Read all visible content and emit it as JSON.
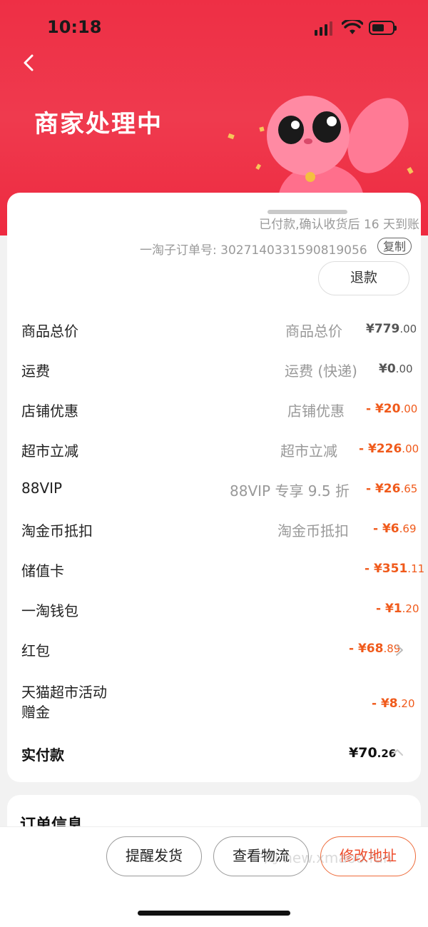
{
  "status": {
    "time": "10:18"
  },
  "header": {
    "title": "商家处理中"
  },
  "order": {
    "paid_note": "已付款,确认收货后 16 天到账",
    "order_no_label": "一淘子订单号: 3027140331590819056",
    "copy_label": "复制",
    "refund_label": "退款"
  },
  "rows": [
    {
      "label": "商品总价",
      "desc": "商品总价",
      "amount_int": "¥779",
      "amount_dec": ".00",
      "red": false
    },
    {
      "label": "运费",
      "desc": "运费 (快递)",
      "amount_int": "¥0",
      "amount_dec": ".00",
      "red": false
    },
    {
      "label": "店铺优惠",
      "desc": "店铺优惠",
      "amount_int": "- ¥20",
      "amount_dec": ".00",
      "red": true
    },
    {
      "label": "超市立减",
      "desc": "超市立减",
      "amount_int": "- ¥226",
      "amount_dec": ".00",
      "red": true
    },
    {
      "label": "88VIP",
      "desc": "88VIP 专享 9.5 折",
      "amount_int": "- ¥26",
      "amount_dec": ".65",
      "red": true
    },
    {
      "label": "淘金币抵扣",
      "desc": "淘金币抵扣",
      "amount_int": "- ¥6",
      "amount_dec": ".69",
      "red": true
    },
    {
      "label": "储值卡",
      "desc": "",
      "amount_int": "- ¥351",
      "amount_dec": ".11",
      "red": true
    },
    {
      "label": "一淘钱包",
      "desc": "",
      "amount_int": "- ¥1",
      "amount_dec": ".20",
      "red": true
    },
    {
      "label": "红包",
      "desc": "",
      "amount_int": "- ¥68",
      "amount_dec": ".89",
      "red": true
    },
    {
      "label_line1": "天猫超市活动",
      "label_line2": "赠金",
      "amount_int": "- ¥8",
      "amount_dec": ".20",
      "red": true
    }
  ],
  "total": {
    "label": "实付款",
    "amount_int": "¥70",
    "amount_dec": ".26"
  },
  "info": {
    "title": "订单信息"
  },
  "actions": {
    "remind": "提醒发货",
    "logistics": "查看物流",
    "change_address": "修改地址"
  },
  "watermark": "一淘-new.xmaoo.fun",
  "colors": {
    "brand_red": "#ee2f45",
    "discount_orange": "#f05a1b"
  }
}
